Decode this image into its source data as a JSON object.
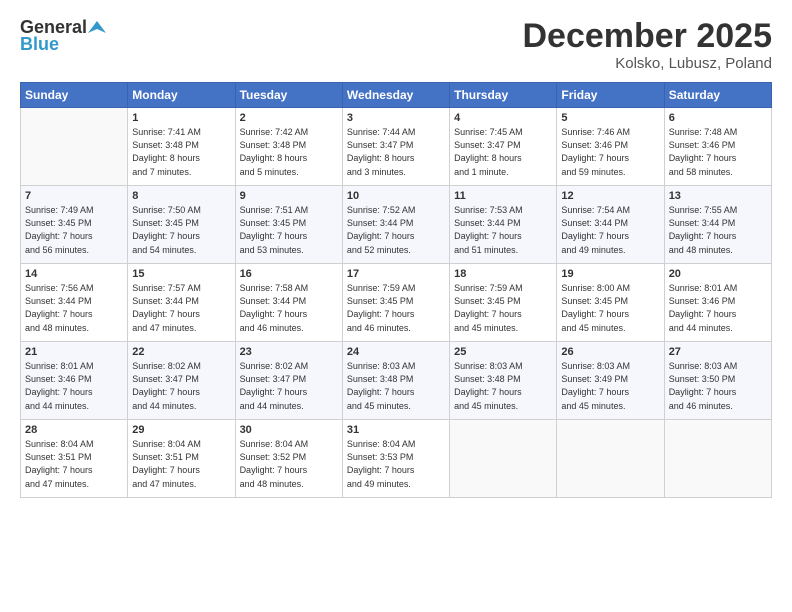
{
  "logo": {
    "general": "General",
    "blue": "Blue"
  },
  "header": {
    "month": "December 2025",
    "location": "Kolsko, Lubusz, Poland"
  },
  "days_of_week": [
    "Sunday",
    "Monday",
    "Tuesday",
    "Wednesday",
    "Thursday",
    "Friday",
    "Saturday"
  ],
  "weeks": [
    [
      {
        "day": "",
        "info": ""
      },
      {
        "day": "1",
        "info": "Sunrise: 7:41 AM\nSunset: 3:48 PM\nDaylight: 8 hours\nand 7 minutes."
      },
      {
        "day": "2",
        "info": "Sunrise: 7:42 AM\nSunset: 3:48 PM\nDaylight: 8 hours\nand 5 minutes."
      },
      {
        "day": "3",
        "info": "Sunrise: 7:44 AM\nSunset: 3:47 PM\nDaylight: 8 hours\nand 3 minutes."
      },
      {
        "day": "4",
        "info": "Sunrise: 7:45 AM\nSunset: 3:47 PM\nDaylight: 8 hours\nand 1 minute."
      },
      {
        "day": "5",
        "info": "Sunrise: 7:46 AM\nSunset: 3:46 PM\nDaylight: 7 hours\nand 59 minutes."
      },
      {
        "day": "6",
        "info": "Sunrise: 7:48 AM\nSunset: 3:46 PM\nDaylight: 7 hours\nand 58 minutes."
      }
    ],
    [
      {
        "day": "7",
        "info": "Sunrise: 7:49 AM\nSunset: 3:45 PM\nDaylight: 7 hours\nand 56 minutes."
      },
      {
        "day": "8",
        "info": "Sunrise: 7:50 AM\nSunset: 3:45 PM\nDaylight: 7 hours\nand 54 minutes."
      },
      {
        "day": "9",
        "info": "Sunrise: 7:51 AM\nSunset: 3:45 PM\nDaylight: 7 hours\nand 53 minutes."
      },
      {
        "day": "10",
        "info": "Sunrise: 7:52 AM\nSunset: 3:44 PM\nDaylight: 7 hours\nand 52 minutes."
      },
      {
        "day": "11",
        "info": "Sunrise: 7:53 AM\nSunset: 3:44 PM\nDaylight: 7 hours\nand 51 minutes."
      },
      {
        "day": "12",
        "info": "Sunrise: 7:54 AM\nSunset: 3:44 PM\nDaylight: 7 hours\nand 49 minutes."
      },
      {
        "day": "13",
        "info": "Sunrise: 7:55 AM\nSunset: 3:44 PM\nDaylight: 7 hours\nand 48 minutes."
      }
    ],
    [
      {
        "day": "14",
        "info": "Sunrise: 7:56 AM\nSunset: 3:44 PM\nDaylight: 7 hours\nand 48 minutes."
      },
      {
        "day": "15",
        "info": "Sunrise: 7:57 AM\nSunset: 3:44 PM\nDaylight: 7 hours\nand 47 minutes."
      },
      {
        "day": "16",
        "info": "Sunrise: 7:58 AM\nSunset: 3:44 PM\nDaylight: 7 hours\nand 46 minutes."
      },
      {
        "day": "17",
        "info": "Sunrise: 7:59 AM\nSunset: 3:45 PM\nDaylight: 7 hours\nand 46 minutes."
      },
      {
        "day": "18",
        "info": "Sunrise: 7:59 AM\nSunset: 3:45 PM\nDaylight: 7 hours\nand 45 minutes."
      },
      {
        "day": "19",
        "info": "Sunrise: 8:00 AM\nSunset: 3:45 PM\nDaylight: 7 hours\nand 45 minutes."
      },
      {
        "day": "20",
        "info": "Sunrise: 8:01 AM\nSunset: 3:46 PM\nDaylight: 7 hours\nand 44 minutes."
      }
    ],
    [
      {
        "day": "21",
        "info": "Sunrise: 8:01 AM\nSunset: 3:46 PM\nDaylight: 7 hours\nand 44 minutes."
      },
      {
        "day": "22",
        "info": "Sunrise: 8:02 AM\nSunset: 3:47 PM\nDaylight: 7 hours\nand 44 minutes."
      },
      {
        "day": "23",
        "info": "Sunrise: 8:02 AM\nSunset: 3:47 PM\nDaylight: 7 hours\nand 44 minutes."
      },
      {
        "day": "24",
        "info": "Sunrise: 8:03 AM\nSunset: 3:48 PM\nDaylight: 7 hours\nand 45 minutes."
      },
      {
        "day": "25",
        "info": "Sunrise: 8:03 AM\nSunset: 3:48 PM\nDaylight: 7 hours\nand 45 minutes."
      },
      {
        "day": "26",
        "info": "Sunrise: 8:03 AM\nSunset: 3:49 PM\nDaylight: 7 hours\nand 45 minutes."
      },
      {
        "day": "27",
        "info": "Sunrise: 8:03 AM\nSunset: 3:50 PM\nDaylight: 7 hours\nand 46 minutes."
      }
    ],
    [
      {
        "day": "28",
        "info": "Sunrise: 8:04 AM\nSunset: 3:51 PM\nDaylight: 7 hours\nand 47 minutes."
      },
      {
        "day": "29",
        "info": "Sunrise: 8:04 AM\nSunset: 3:51 PM\nDaylight: 7 hours\nand 47 minutes."
      },
      {
        "day": "30",
        "info": "Sunrise: 8:04 AM\nSunset: 3:52 PM\nDaylight: 7 hours\nand 48 minutes."
      },
      {
        "day": "31",
        "info": "Sunrise: 8:04 AM\nSunset: 3:53 PM\nDaylight: 7 hours\nand 49 minutes."
      },
      {
        "day": "",
        "info": ""
      },
      {
        "day": "",
        "info": ""
      },
      {
        "day": "",
        "info": ""
      }
    ]
  ]
}
